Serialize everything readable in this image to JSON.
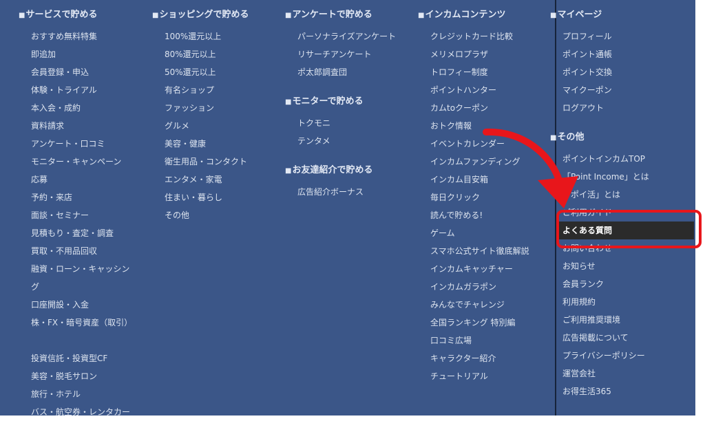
{
  "colors": {
    "background": "#3b5688",
    "text": "#dde4ef",
    "divider": "#17233a",
    "highlight": "#2b2b2b",
    "annotation": "#e8161b"
  },
  "columns": [
    {
      "heading": "サービスで貯める",
      "items": [
        "おすすめ無料特集",
        "即追加",
        "会員登録・申込",
        "体験・トライアル",
        "本入会・成約",
        "資料請求",
        "アンケート・口コミ",
        "モニター・キャンペーン",
        "応募",
        "予約・来店",
        "面談・セミナー",
        "見積もり・査定・調査",
        "買取・不用品回収",
        "融資・ローン・キャッシング",
        "口座開設・入金",
        "株・FX・暗号資産（取引）",
        "投資信託・投資型CF",
        "美容・脱毛サロン",
        "旅行・ホテル",
        "バス・航空券・レンタカー"
      ]
    },
    {
      "heading": "ショッピングで貯める",
      "items": [
        "100%還元以上",
        "80%還元以上",
        "50%還元以上",
        "有名ショップ",
        "ファッション",
        "グルメ",
        "美容・健康",
        "衛生用品・コンタクト",
        "エンタメ・家電",
        "住まい・暮らし",
        "その他"
      ]
    },
    {
      "heading": "アンケートで貯める",
      "items": [
        "パーソナライズアンケート",
        "リサーチアンケート",
        "ポ太郎調査団"
      ]
    },
    {
      "heading": "モニターで貯める",
      "items": [
        "トクモニ",
        "テンタメ"
      ]
    },
    {
      "heading": "お友達紹介で貯める",
      "items": [
        "広告紹介ボーナス"
      ]
    },
    {
      "heading": "インカムコンテンツ",
      "items": [
        "クレジットカード比較",
        "メリメロプラザ",
        "トロフィー制度",
        "ポイントハンター",
        "カムtoクーポン",
        "おトク情報",
        "イベントカレンダー",
        "インカムファンディング",
        "インカム目安箱",
        "毎日クリック",
        "読んで貯める!",
        "ゲーム",
        "スマホ公式サイト徹底解説",
        "インカムキャッチャー",
        "インカムガラポン",
        "みんなでチャレンジ",
        "全国ランキング 特別編",
        "口コミ広場",
        "キャラクター紹介",
        "チュートリアル"
      ]
    },
    {
      "heading": "マイページ",
      "items": [
        "プロフィール",
        "ポイント通帳",
        "ポイント交換",
        "マイクーポン",
        "ログアウト"
      ]
    },
    {
      "heading": "その他",
      "items": [
        "ポイントインカムTOP",
        "「Point Income」とは",
        "「ポイ活」とは",
        "ご利用ガイド",
        "よくある質問",
        "お問い合わせ",
        "お知らせ",
        "会員ランク",
        "利用規約",
        "ご利用推奨環境",
        "広告掲載について",
        "プライバシーポリシー",
        "運営会社",
        "お得生活365"
      ]
    }
  ]
}
